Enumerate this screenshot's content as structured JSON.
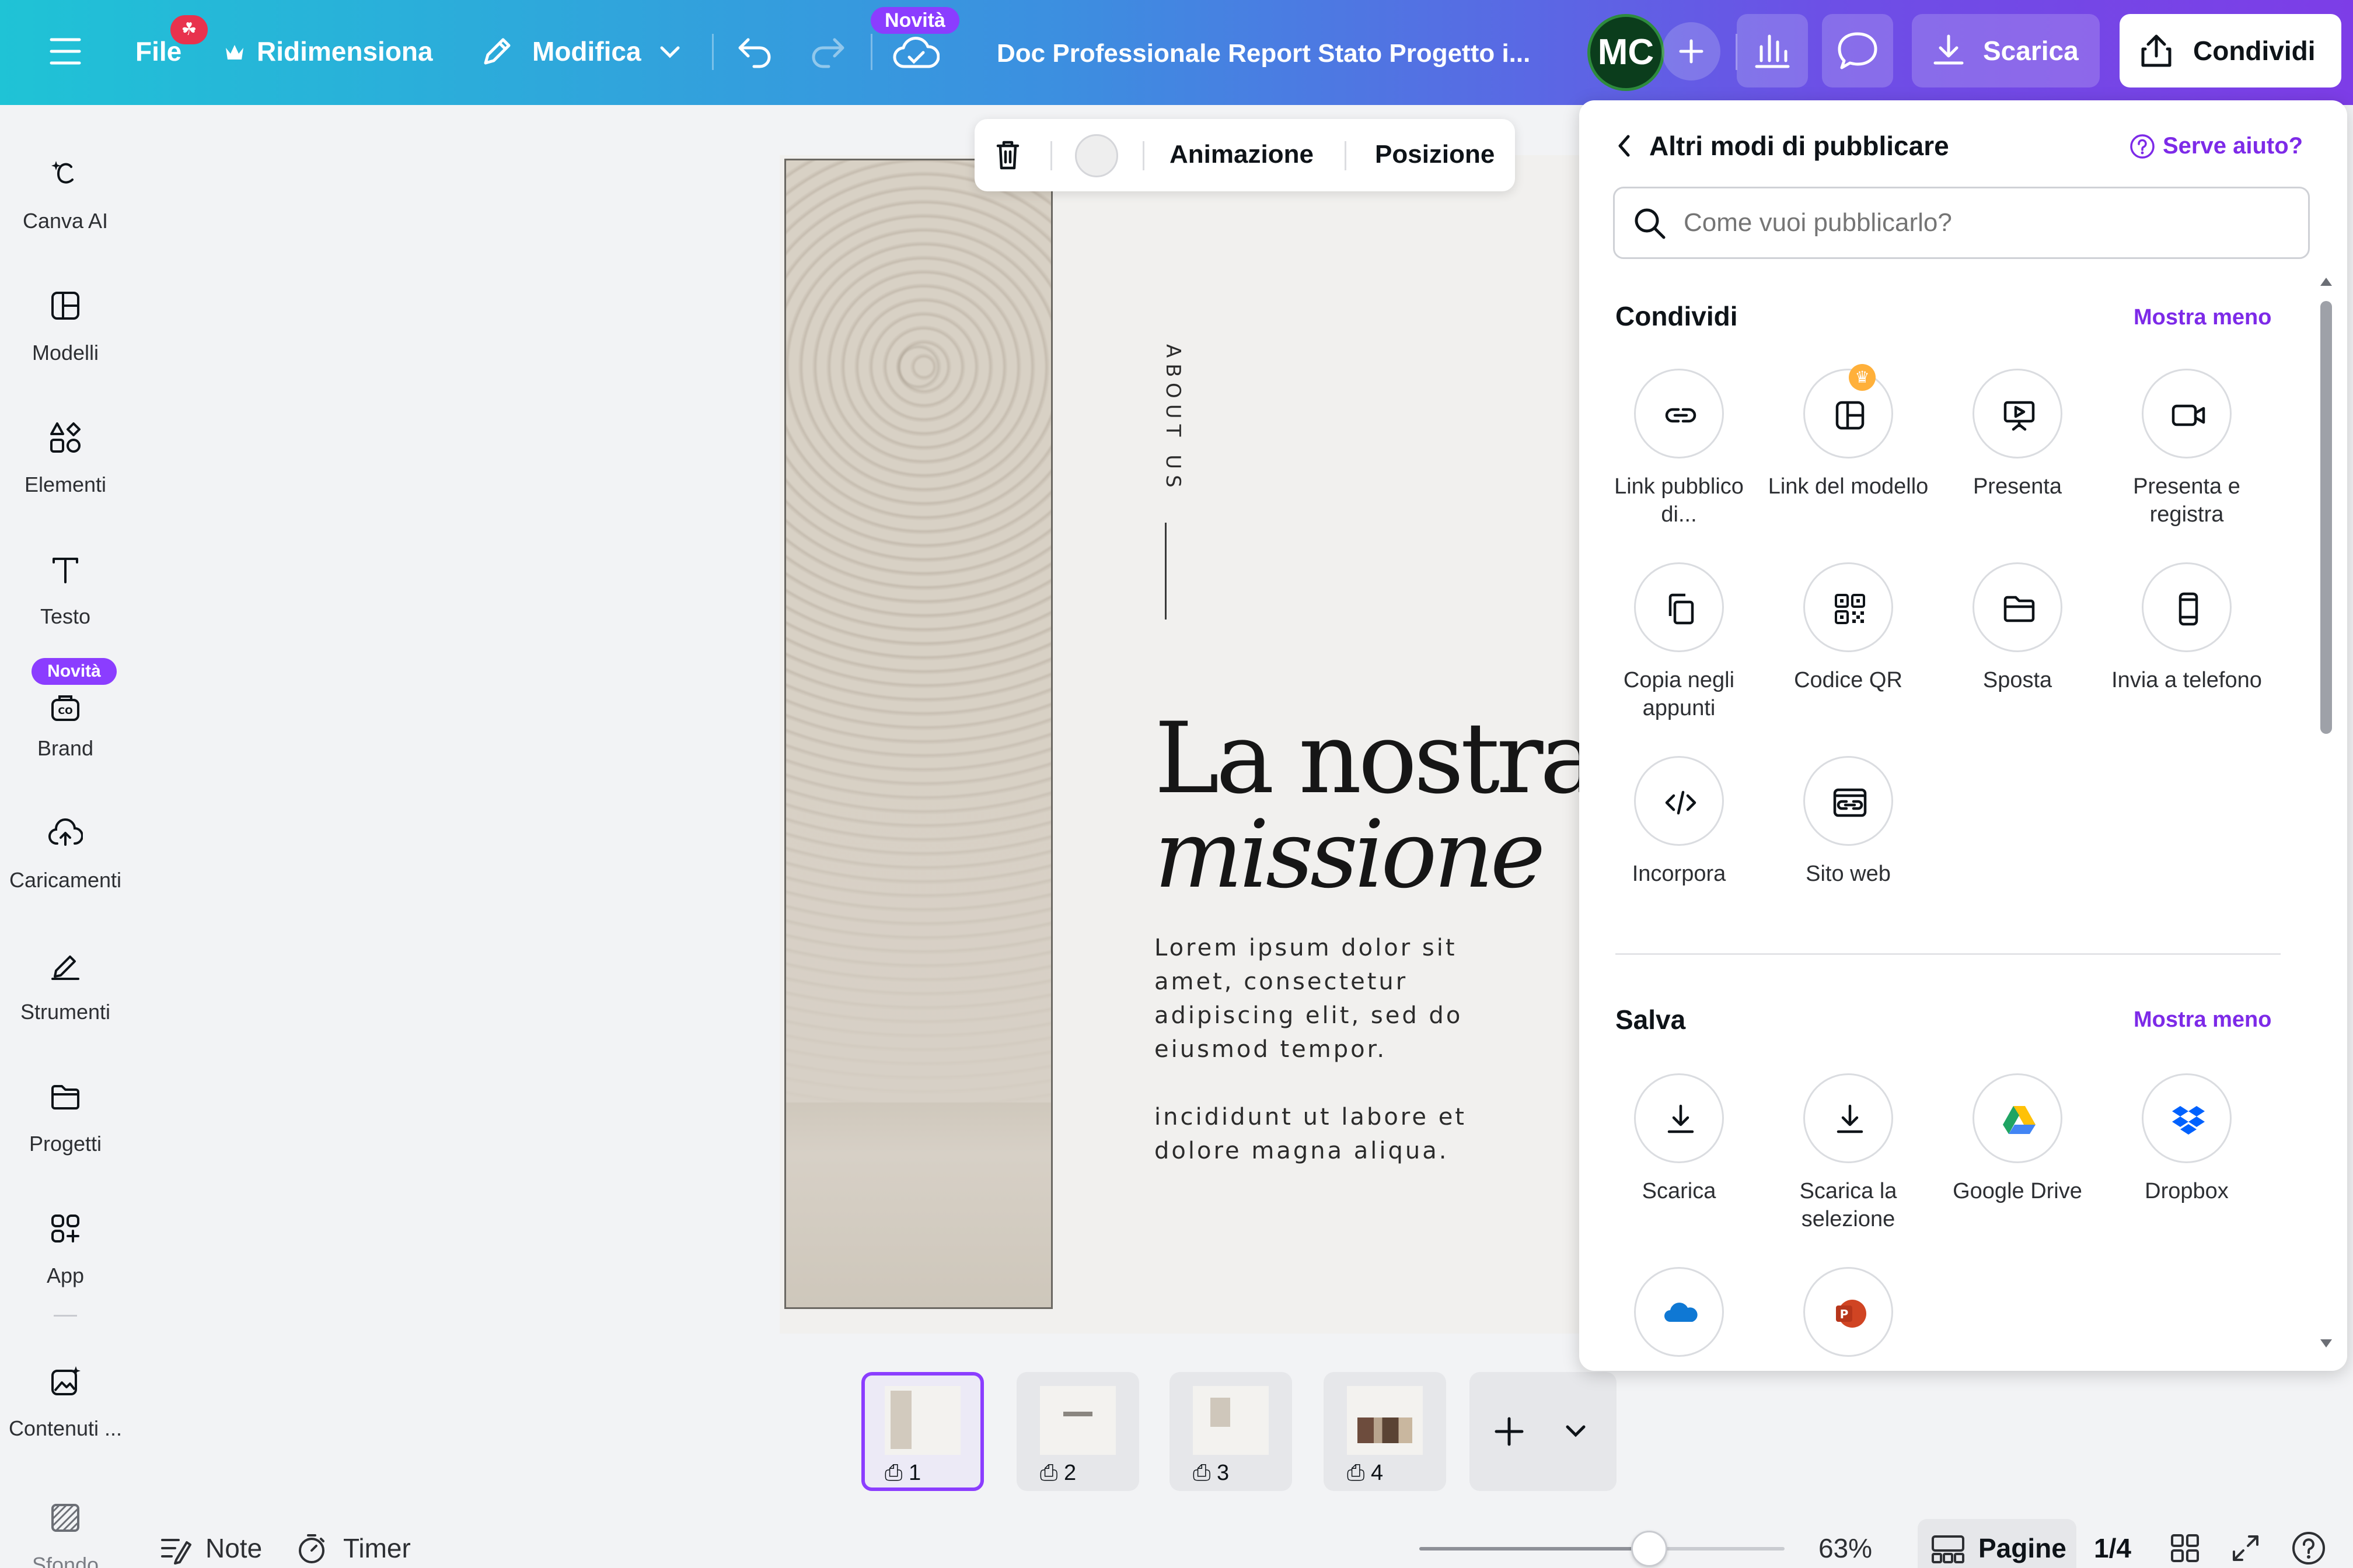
{
  "topbar": {
    "menu_icon": "hamburger-icon",
    "file_label": "File",
    "file_badge": "☘",
    "resize_label": "Ridimensiona",
    "resize_icon": "crown-icon",
    "edit_label": "Modifica",
    "edit_icon": "pencil-icon",
    "new_badge": "Novità",
    "doc_title": "Doc Professionale Report Stato Progetto i...",
    "avatar_initials": "MC",
    "download_label": "Scarica",
    "share_label": "Condividi"
  },
  "sidebar": {
    "items": [
      {
        "label": "Canva AI",
        "icon": "canva-ai-icon"
      },
      {
        "label": "Modelli",
        "icon": "templates-icon"
      },
      {
        "label": "Elementi",
        "icon": "elements-icon"
      },
      {
        "label": "Testo",
        "icon": "text-icon"
      },
      {
        "label": "Brand",
        "icon": "brand-icon",
        "badge": "Novità"
      },
      {
        "label": "Caricamenti",
        "icon": "upload-icon"
      },
      {
        "label": "Strumenti",
        "icon": "tools-icon"
      },
      {
        "label": "Progetti",
        "icon": "folder-icon"
      },
      {
        "label": "App",
        "icon": "apps-icon"
      },
      {
        "label": "Contenuti ...",
        "icon": "magic-media-icon"
      },
      {
        "label": "Sfondo",
        "icon": "background-icon"
      }
    ]
  },
  "float_toolbar": {
    "animation_label": "Animazione",
    "position_label": "Posizione"
  },
  "canvas": {
    "vertical_text": "ABOUT US",
    "title_line1": "La nostra",
    "title_line2": "missione",
    "paragraph1": "Lorem ipsum dolor sit amet, consectetur adipiscing elit, sed do eiusmod tempor.",
    "paragraph2": "incididunt ut labore et dolore magna aliqua."
  },
  "pages": {
    "thumbnails": [
      "1",
      "2",
      "3",
      "4"
    ],
    "active": 1
  },
  "bottombar": {
    "notes_label": "Note",
    "timer_label": "Timer",
    "zoom_level": "63%",
    "zoom_fraction": 0.63,
    "pages_label": "Pagine",
    "page_counter": "1/4"
  },
  "share_panel": {
    "header_title": "Altri modi di pubblicare",
    "help_label": "Serve aiuto?",
    "search_placeholder": "Come vuoi pubblicarlo?",
    "share_section": {
      "title": "Condividi",
      "toggle_label": "Mostra meno",
      "options": [
        {
          "label": "Link pubblico di...",
          "icon": "link-icon"
        },
        {
          "label": "Link del modello",
          "icon": "template-link-icon",
          "premium": true
        },
        {
          "label": "Presenta",
          "icon": "present-icon"
        },
        {
          "label": "Presenta e registra",
          "icon": "record-icon"
        },
        {
          "label": "Copia negli appunti",
          "icon": "copy-icon"
        },
        {
          "label": "Codice QR",
          "icon": "qr-code-icon"
        },
        {
          "label": "Sposta",
          "icon": "move-folder-icon"
        },
        {
          "label": "Invia a telefono",
          "icon": "phone-icon"
        },
        {
          "label": "Incorpora",
          "icon": "embed-code-icon"
        },
        {
          "label": "Sito web",
          "icon": "website-icon"
        }
      ]
    },
    "save_section": {
      "title": "Salva",
      "toggle_label": "Mostra meno",
      "options": [
        {
          "label": "Scarica",
          "icon": "download-icon"
        },
        {
          "label": "Scarica la selezione",
          "icon": "download-selection-icon"
        },
        {
          "label": "Google Drive",
          "icon": "google-drive-icon"
        },
        {
          "label": "Dropbox",
          "icon": "dropbox-icon"
        },
        {
          "label": "",
          "icon": "onedrive-icon"
        },
        {
          "label": "",
          "icon": "powerpoint-icon"
        }
      ]
    }
  },
  "colors": {
    "accent": "#8b3dff",
    "link": "#7d2ae8",
    "gradient_start": "#1fc3d6",
    "gradient_end": "#7d3de7"
  }
}
